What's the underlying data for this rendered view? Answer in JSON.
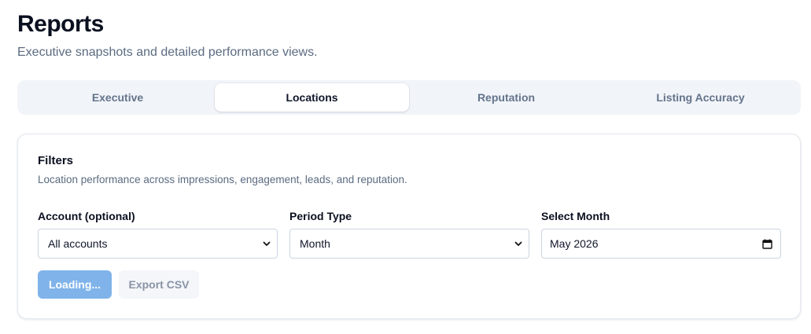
{
  "header": {
    "title": "Reports",
    "subtitle": "Executive snapshots and detailed performance views."
  },
  "tabs": [
    {
      "label": "Executive",
      "active": false
    },
    {
      "label": "Locations",
      "active": true
    },
    {
      "label": "Reputation",
      "active": false
    },
    {
      "label": "Listing Accuracy",
      "active": false
    }
  ],
  "filters": {
    "title": "Filters",
    "description": "Location performance across impressions, engagement, leads, and reputation.",
    "account": {
      "label": "Account (optional)",
      "value": "All accounts"
    },
    "period_type": {
      "label": "Period Type",
      "value": "Month"
    },
    "select_month": {
      "label": "Select Month",
      "value": "May 2026"
    },
    "buttons": {
      "loading_label": "Loading...",
      "export_label": "Export CSV"
    }
  },
  "colors": {
    "accent_disabled": "#7fb3ea",
    "tab_bg": "#f1f4f9",
    "muted_text": "#5b6b80"
  },
  "icons": {
    "select_chevron": "chevron-down-icon",
    "date_picker": "calendar-icon"
  }
}
